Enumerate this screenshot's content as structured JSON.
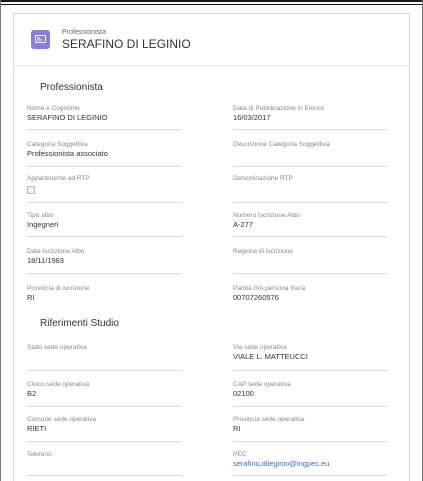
{
  "header": {
    "subtitle": "Professionista",
    "title": "SERAFINO DI LEGINIO",
    "icon": "id-card-icon"
  },
  "sections": {
    "professionista": "Professionista",
    "studio": "Riferimenti Studio"
  },
  "fields": {
    "nome": {
      "label": "Nome e Cognome",
      "value": "SERAFINO DI LEGINIO"
    },
    "data_pub": {
      "label": "Data di Pubblicazione in Elenco",
      "value": "16/03/2017"
    },
    "categoria": {
      "label": "Categoria Soggettiva",
      "value": "Professionista associato"
    },
    "desc_categoria": {
      "label": "Descrizione Categoria Soggettiva",
      "value": ""
    },
    "rtp": {
      "label": "Appartenente ad RTP",
      "checked": false
    },
    "denom_rtp": {
      "label": "Denominazione RTP",
      "value": ""
    },
    "tipo_albo": {
      "label": "Tipo albo",
      "value": "Ingegneri"
    },
    "num_albo": {
      "label": "Numero Iscrizione Albo",
      "value": "A-277"
    },
    "data_albo": {
      "label": "Data Iscrizione Albo",
      "value": "18/11/1983"
    },
    "regione": {
      "label": "Regione di iscrizione",
      "value": ""
    },
    "provincia": {
      "label": "Provincia di iscrizione",
      "value": "RI"
    },
    "piva": {
      "label": "Partita IVA persona fisica",
      "value": "00707260576"
    },
    "stato_sede": {
      "label": "Stato sede operativa",
      "value": ""
    },
    "via_sede": {
      "label": "Via sede operativa",
      "value": "VIALE L. MATTEUCCI"
    },
    "civico": {
      "label": "Civico sede operativa",
      "value": "B2"
    },
    "cap": {
      "label": "CAP sede operativa",
      "value": "02100"
    },
    "comune": {
      "label": "Comune sede operativa",
      "value": "RIETI"
    },
    "prov_sede": {
      "label": "Provincia sede operativa",
      "value": "RI"
    },
    "telefono": {
      "label": "Telefono",
      "value": ""
    },
    "pec": {
      "label": "PEC",
      "value": "serafino.dileginio@ingpec.eu"
    }
  }
}
